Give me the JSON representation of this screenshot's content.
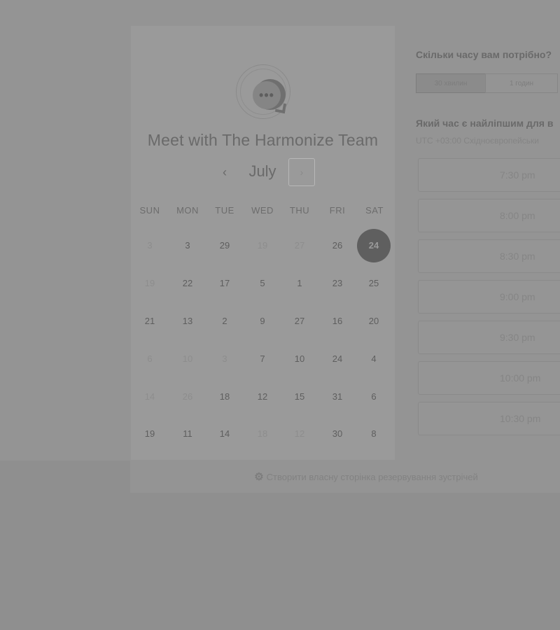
{
  "calendar": {
    "title": "Meet with The Harmonize Team",
    "month": "July",
    "prev_icon": "‹",
    "next_icon": "›",
    "weekdays": [
      "SUN",
      "MON",
      "TUE",
      "WED",
      "THU",
      "FRI",
      "SAT"
    ],
    "weeks": [
      [
        {
          "d": "3",
          "s": "disabled"
        },
        {
          "d": "3",
          "s": "enabled"
        },
        {
          "d": "29",
          "s": "enabled"
        },
        {
          "d": "19",
          "s": "disabled"
        },
        {
          "d": "27",
          "s": "disabled"
        },
        {
          "d": "26",
          "s": "enabled"
        },
        {
          "d": "24",
          "s": "selected"
        }
      ],
      [
        {
          "d": "19",
          "s": "disabled"
        },
        {
          "d": "22",
          "s": "enabled"
        },
        {
          "d": "17",
          "s": "enabled"
        },
        {
          "d": "5",
          "s": "enabled"
        },
        {
          "d": "1",
          "s": "enabled"
        },
        {
          "d": "23",
          "s": "enabled"
        },
        {
          "d": "25",
          "s": "enabled"
        }
      ],
      [
        {
          "d": "21",
          "s": "enabled"
        },
        {
          "d": "13",
          "s": "enabled"
        },
        {
          "d": "2",
          "s": "enabled"
        },
        {
          "d": "9",
          "s": "enabled"
        },
        {
          "d": "27",
          "s": "enabled"
        },
        {
          "d": "16",
          "s": "enabled"
        },
        {
          "d": "20",
          "s": "enabled"
        }
      ],
      [
        {
          "d": "6",
          "s": "disabled"
        },
        {
          "d": "10",
          "s": "disabled"
        },
        {
          "d": "3",
          "s": "disabled"
        },
        {
          "d": "7",
          "s": "enabled"
        },
        {
          "d": "10",
          "s": "enabled"
        },
        {
          "d": "24",
          "s": "enabled"
        },
        {
          "d": "4",
          "s": "enabled"
        }
      ],
      [
        {
          "d": "14",
          "s": "disabled"
        },
        {
          "d": "26",
          "s": "disabled"
        },
        {
          "d": "18",
          "s": "enabled"
        },
        {
          "d": "12",
          "s": "enabled"
        },
        {
          "d": "15",
          "s": "enabled"
        },
        {
          "d": "31",
          "s": "enabled"
        },
        {
          "d": "6",
          "s": "enabled"
        }
      ],
      [
        {
          "d": "19",
          "s": "enabled"
        },
        {
          "d": "11",
          "s": "enabled"
        },
        {
          "d": "14",
          "s": "enabled"
        },
        {
          "d": "18",
          "s": "disabled"
        },
        {
          "d": "12",
          "s": "disabled"
        },
        {
          "d": "30",
          "s": "enabled"
        },
        {
          "d": "8",
          "s": "enabled"
        }
      ]
    ]
  },
  "booking": {
    "duration_question": "Скільки часу вам потрібно?",
    "durations": [
      "30 хвилин",
      "1 годин"
    ],
    "time_question": "Який час є найліпшим для в",
    "timezone": "UTC +03:00 Східноєвропейськи",
    "slots": [
      "7:30 pm",
      "8:00 pm",
      "8:30 pm",
      "9:00 pm",
      "9:30 pm",
      "10:00 pm",
      "10:30 pm"
    ]
  },
  "footer": {
    "link_text": "Створити власну сторінка резервування зустрічей",
    "icon": "hubspot-icon"
  },
  "colors": {
    "overlay": "#949494",
    "selected_day": "#5f5f5f"
  }
}
